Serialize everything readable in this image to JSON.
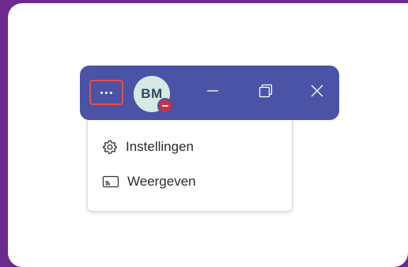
{
  "menu": {
    "items": [
      {
        "label": "Instellingen",
        "icon": "gear-icon"
      },
      {
        "label": "Weergeven",
        "icon": "cast-screen-icon"
      }
    ]
  },
  "titlebar": {
    "more_icon": "more-options-icon",
    "avatar_initials": "BM",
    "presence_status": "do-not-disturb",
    "colors": {
      "titlebar_bg": "#4b53a6",
      "highlight_border": "#e3504b",
      "presence": "#c4314b",
      "avatar_bg": "#d7e9e4",
      "page_bg": "#6a2a8e"
    }
  }
}
